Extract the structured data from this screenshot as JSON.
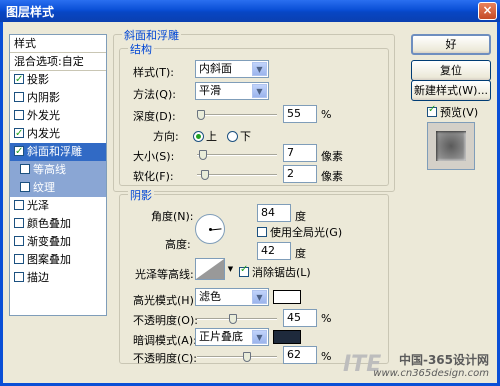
{
  "window": {
    "title": "图层样式",
    "close_glyph": "×"
  },
  "left_panel": {
    "header": "样式",
    "blend": "混合选项:自定",
    "items": [
      {
        "label": "投影",
        "checked": true
      },
      {
        "label": "内阴影",
        "checked": false
      },
      {
        "label": "外发光",
        "checked": false
      },
      {
        "label": "内发光",
        "checked": true
      },
      {
        "label": "斜面和浮雕",
        "checked": true,
        "selected": true
      },
      {
        "label": "等高线",
        "checked": false,
        "sub": true
      },
      {
        "label": "纹理",
        "checked": false,
        "sub": true
      },
      {
        "label": "光泽",
        "checked": false
      },
      {
        "label": "颜色叠加",
        "checked": false
      },
      {
        "label": "渐变叠加",
        "checked": false
      },
      {
        "label": "图案叠加",
        "checked": false
      },
      {
        "label": "描边",
        "checked": false
      }
    ]
  },
  "bevel": {
    "section_title": "斜面和浮雕",
    "structure_title": "结构",
    "style_label": "样式(T):",
    "style_value": "内斜面",
    "method_label": "方法(Q):",
    "method_value": "平滑",
    "depth_label": "深度(D):",
    "depth_value": "55",
    "depth_unit": "%",
    "depth_level": 0.05,
    "direction_label": "方向:",
    "dir_up": "上",
    "dir_down": "下",
    "size_label": "大小(S):",
    "size_value": "7",
    "size_unit": "像素",
    "size_level": 0.07,
    "soften_label": "软化(F):",
    "soften_value": "2",
    "soften_unit": "像素",
    "soften_level": 0.1
  },
  "shading": {
    "title": "阴影",
    "angle_label": "角度(N):",
    "angle_value": "84",
    "angle_unit": "度",
    "global_light": "使用全局光(G)",
    "altitude_label": "高度:",
    "altitude_value": "42",
    "altitude_unit": "度",
    "gloss_label": "光泽等高线:",
    "antialias": "消除锯齿(L)",
    "highlight_label": "高光模式(H):",
    "highlight_value": "滤色",
    "highlight_color": "#ffffff",
    "hl_opacity_label": "不透明度(O):",
    "hl_opacity_value": "45",
    "hl_opacity_unit": "%",
    "hl_opacity_level": 0.45,
    "shadow_label": "暗调模式(A):",
    "shadow_value": "正片叠底",
    "shadow_color": "#1e2a3c",
    "sh_opacity_label": "不透明度(C):",
    "sh_opacity_value": "62",
    "sh_opacity_unit": "%",
    "sh_opacity_level": 0.62
  },
  "buttons": {
    "ok": "好",
    "reset": "复位",
    "new_style": "新建样式(W)...",
    "preview": "预览(V)"
  },
  "watermark": {
    "logo": "ITE",
    "cn": "中国-365设计网",
    "url": "www.cn365design.com"
  }
}
